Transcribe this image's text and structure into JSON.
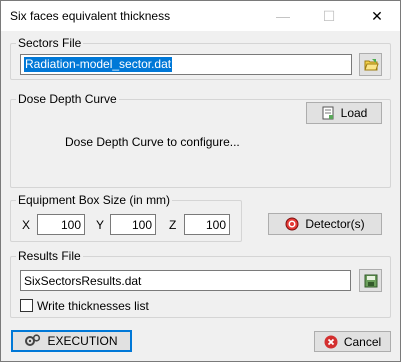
{
  "window": {
    "title": "Six faces equivalent thickness",
    "minimize_glyph": "—",
    "maximize_glyph": "☐",
    "close_glyph": "✕"
  },
  "sectors_file": {
    "group_label": "Sectors File",
    "value": "Radiation-model_sector.dat",
    "browse_icon": "folder-icon"
  },
  "dose_depth": {
    "group_label": "Dose Depth Curve",
    "load_label": "Load",
    "status_text": "Dose Depth Curve to configure..."
  },
  "equipment_box": {
    "group_label": "Equipment Box Size (in mm)",
    "x_label": "X",
    "x_value": "100",
    "y_label": "Y",
    "y_value": "100",
    "z_label": "Z",
    "z_value": "100"
  },
  "detector_button": {
    "label": "Detector(s)",
    "icon": "detector-icon"
  },
  "results_file": {
    "group_label": "Results File",
    "value": "SixSectorsResults.dat",
    "browse_icon": "save-icon",
    "checkbox_label": "Write thicknesses list",
    "checkbox_checked": false
  },
  "footer": {
    "execution_label": "EXECUTION",
    "cancel_label": "Cancel"
  }
}
